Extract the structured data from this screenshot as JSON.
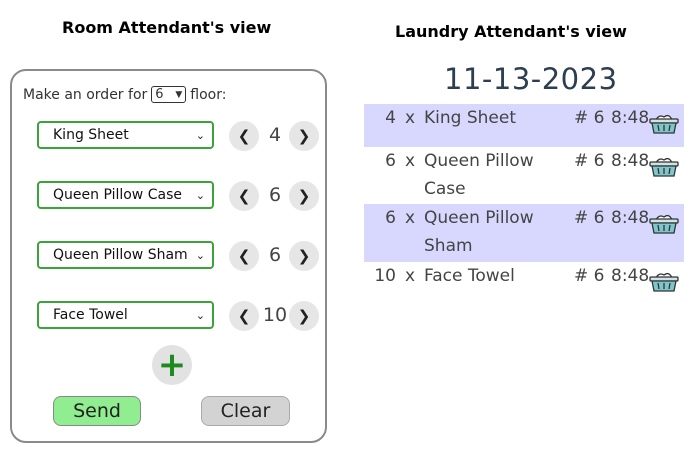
{
  "headings": {
    "room": "Room Attendant's view",
    "laundry": "Laundry Attendant's view"
  },
  "room_panel": {
    "floor_prefix": "Make an order for",
    "floor_value": "6",
    "floor_suffix": "floor:",
    "items": [
      {
        "name": "King Sheet",
        "qty": "4"
      },
      {
        "name": "Queen Pillow Case",
        "qty": "6"
      },
      {
        "name": "Queen Pillow Sham",
        "qty": "6"
      },
      {
        "name": "Face Towel",
        "qty": "10"
      }
    ],
    "prev_glyph": "❮",
    "next_glyph": "❯",
    "add_glyph": "+",
    "send_label": "Send",
    "clear_label": "Clear"
  },
  "laundry_panel": {
    "date": "11-13-2023",
    "orders": [
      {
        "qty": "4",
        "x": "x",
        "name": "King Sheet",
        "floor": "# 6",
        "time": "8:48",
        "highlighted": true
      },
      {
        "qty": "6",
        "x": "x",
        "name": "Queen Pillow Case",
        "floor": "# 6",
        "time": "8:48",
        "highlighted": false
      },
      {
        "qty": "6",
        "x": "x",
        "name": "Queen Pillow Sham",
        "floor": "# 6",
        "time": "8:48",
        "highlighted": true
      },
      {
        "qty": "10",
        "x": "x",
        "name": "Face Towel",
        "floor": "# 6",
        "time": "8:48",
        "highlighted": false
      }
    ]
  },
  "colors": {
    "accent_green": "#3aa43a",
    "send_bg": "#90ee90",
    "highlight_row": "#d8d8ff",
    "date_color": "#2c3e50"
  },
  "icons": [
    "chevron-down-icon",
    "chevron-left-icon",
    "chevron-right-icon",
    "plus-icon",
    "laundry-basket-icon"
  ]
}
